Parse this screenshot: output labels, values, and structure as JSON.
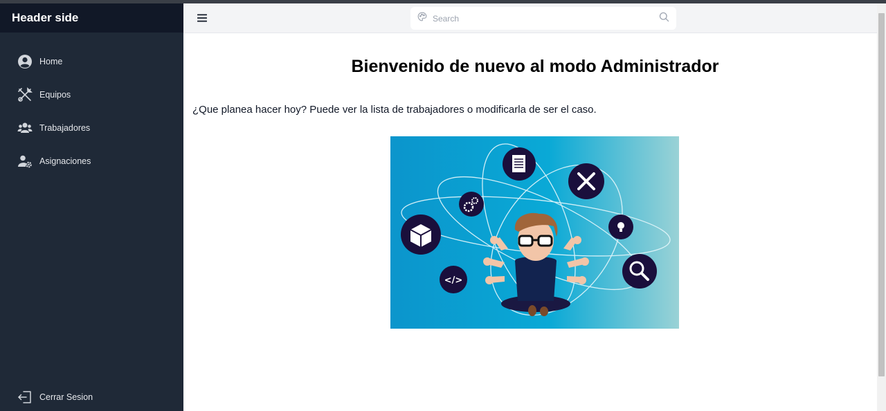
{
  "sidebar": {
    "title": "Header side",
    "items": [
      {
        "label": "Home",
        "icon": "user-circle-icon"
      },
      {
        "label": "Equipos",
        "icon": "tools-icon"
      },
      {
        "label": "Trabajadores",
        "icon": "users-icon"
      },
      {
        "label": "Asignaciones",
        "icon": "user-gear-icon"
      }
    ],
    "logout": {
      "label": "Cerrar Sesion",
      "icon": "logout-icon"
    }
  },
  "topbar": {
    "menu_icon": "hamburger-icon",
    "search": {
      "placeholder": "Search"
    }
  },
  "main": {
    "title": "Bienvenido de nuevo al modo Administrador",
    "intro": "¿Que planea hacer hoy? Puede ver la lista de trabajadores o modificarla de ser el caso."
  },
  "colors": {
    "sidebar_bg": "#1f2937",
    "sidebar_header_bg": "#111827",
    "topbar_bg": "#f3f4f6",
    "illustration_blue": "#0a9fd0",
    "illustration_dark": "#1a0f3c"
  }
}
